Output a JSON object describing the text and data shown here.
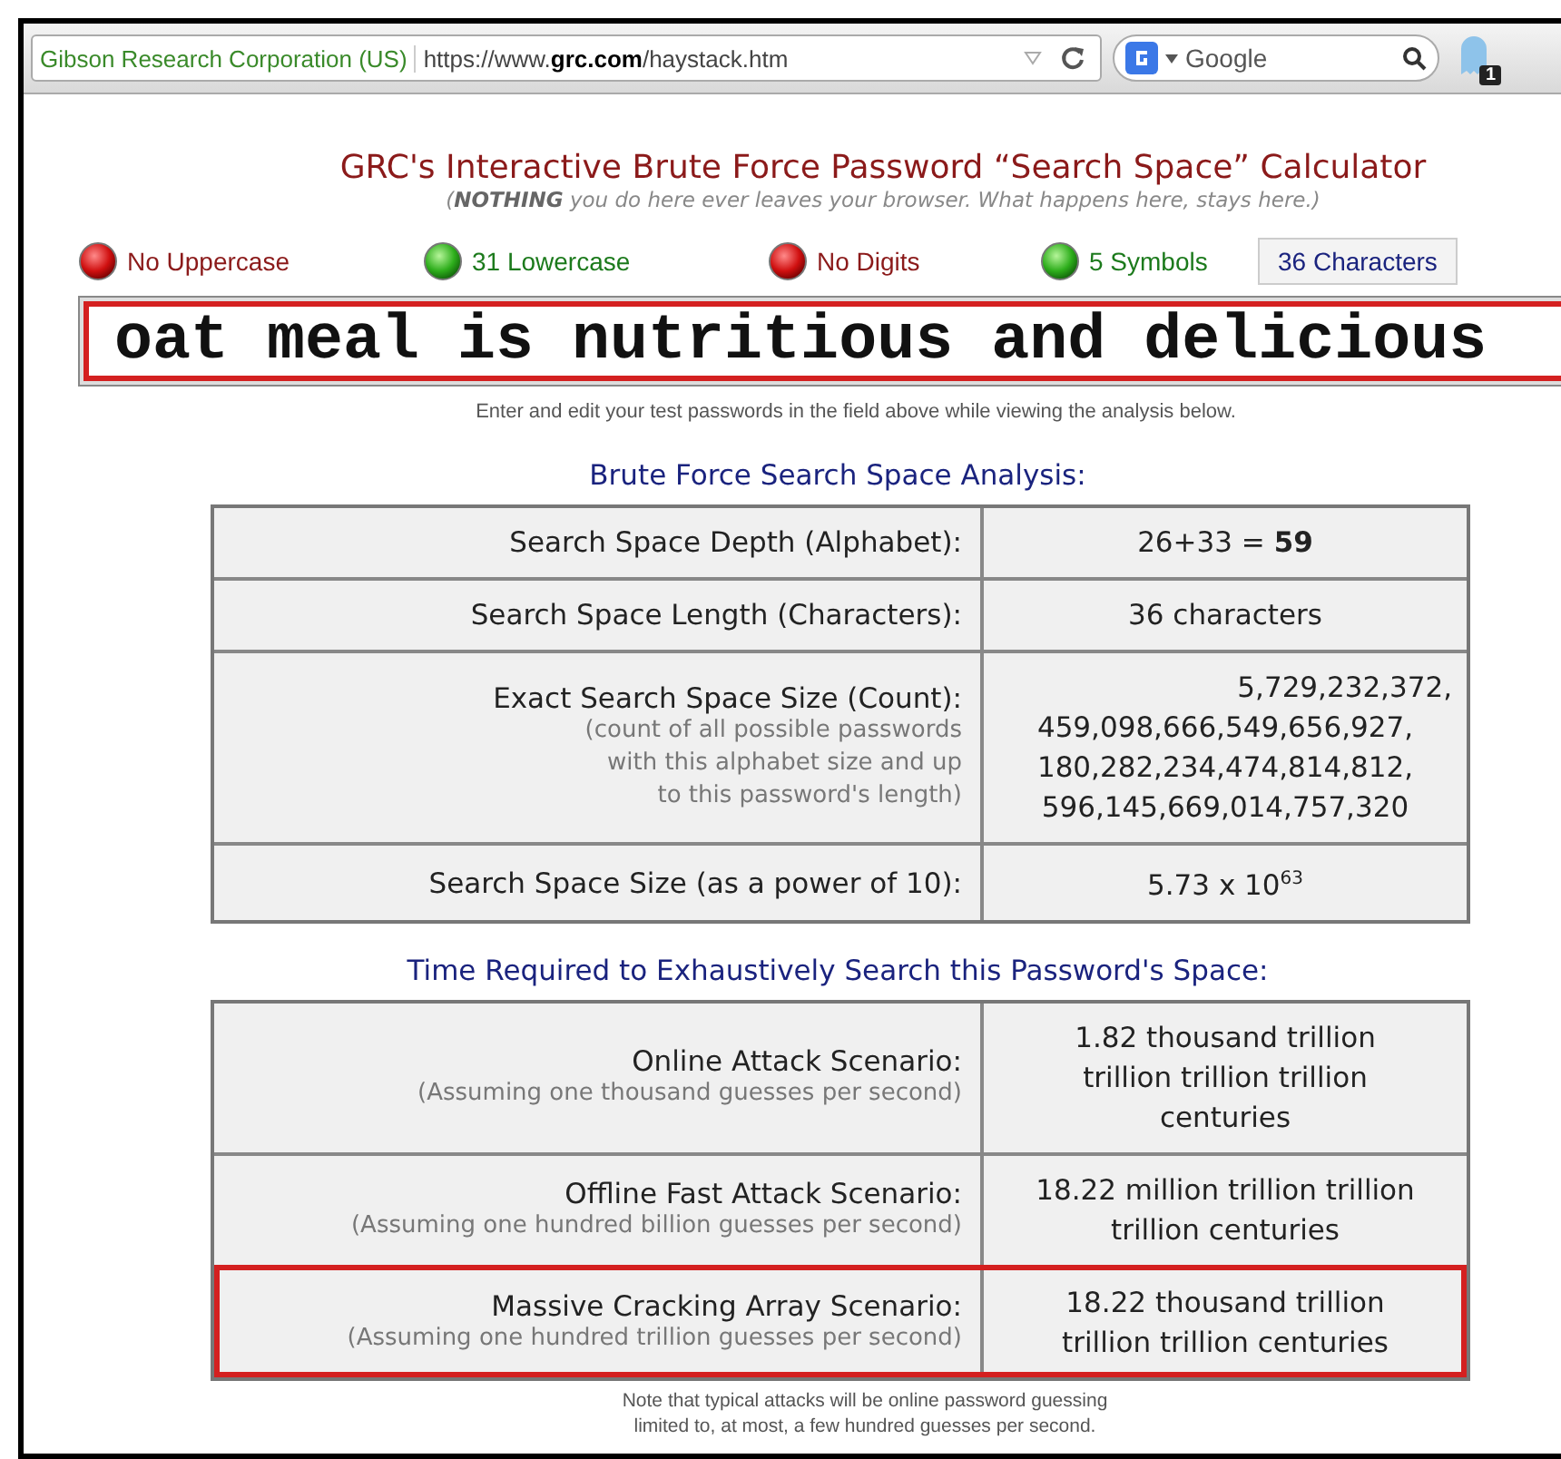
{
  "browser": {
    "site_identity": "Gibson Research Corporation (US)",
    "url": "https://www.**grc.com**/haystack.htm",
    "search_engine": "Google",
    "extension_badge": "1"
  },
  "title": "GRC's Interactive Brute Force Password “Search Space” Calculator",
  "subtitle": "(**NOTHING** you do here ever leaves your browser. What happens here, stays here.)",
  "indicators": [
    {
      "label": "No Uppercase",
      "on": false
    },
    {
      "label": "31 Lowercase",
      "on": true
    },
    {
      "label": "No Digits",
      "on": false
    },
    {
      "label": "5 Symbols",
      "on": true
    }
  ],
  "length_box": "36 Characters",
  "password": {
    "value": "oat meal is nutritious and delicious"
  },
  "hint": "Enter and edit your test passwords in the field above while viewing the analysis below.",
  "analysis": {
    "heading": "Brute Force Search Space Analysis:",
    "rows": [
      {
        "label": "Search Space Depth (Alphabet):",
        "note": [],
        "value": [
          "26+33 = **59**"
        ]
      },
      {
        "label": "Search Space Length (Characters):",
        "note": [],
        "value": [
          "36 characters"
        ]
      },
      {
        "label": "Exact Search Space Size (Count):",
        "note": [
          "(count of all possible passwords",
          "with this alphabet size and up",
          "to this password's length)"
        ],
        "value": [
          "5,729,232,372,",
          "459,098,666,549,656,927,",
          "180,282,234,474,814,812,",
          "596,145,669,014,757,320"
        ]
      },
      {
        "label": "Search Space Size (as a power of 10):",
        "note": [],
        "value": [
          "5.73 x 10$^{63}$"
        ]
      }
    ]
  },
  "time": {
    "heading": "Time Required to Exhaustively Search this Password's Space:",
    "rows": [
      {
        "label": "Online Attack Scenario:",
        "note": [
          "(Assuming one thousand guesses per second)"
        ],
        "value": [
          "1.82 thousand trillion",
          "trillion trillion trillion",
          "centuries"
        ],
        "highlighted": false
      },
      {
        "label": "Offline Fast Attack Scenario:",
        "note": [
          "(Assuming one hundred billion guesses per second)"
        ],
        "value": [
          "18.22 million trillion trillion",
          "trillion centuries"
        ],
        "highlighted": false
      },
      {
        "label": "Massive Cracking Array Scenario:",
        "note": [
          "(Assuming one hundred trillion guesses per second)"
        ],
        "value": [
          "18.22 thousand trillion",
          "trillion trillion centuries"
        ],
        "highlighted": true
      }
    ]
  },
  "footnote": [
    "Note that typical attacks will be online password guessing",
    "limited to, at most, a few hundred guesses per second."
  ]
}
